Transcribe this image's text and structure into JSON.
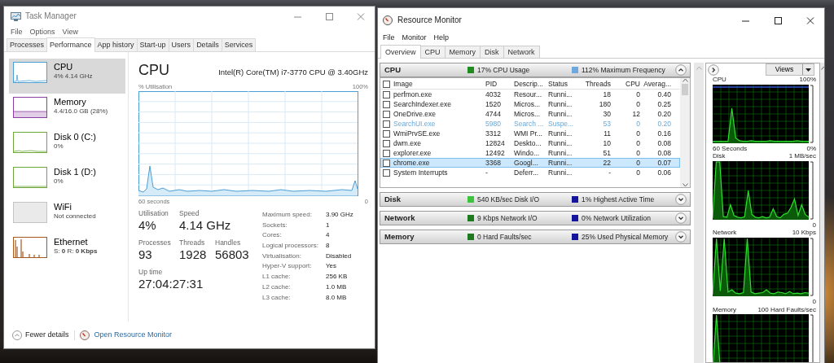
{
  "task_manager": {
    "title": "Task Manager",
    "menu": [
      "File",
      "Options",
      "View"
    ],
    "tabs": [
      {
        "label": "Processes",
        "selected": false
      },
      {
        "label": "Performance",
        "selected": true
      },
      {
        "label": "App history",
        "selected": false
      },
      {
        "label": "Start-up",
        "selected": false
      },
      {
        "label": "Users",
        "selected": false
      },
      {
        "label": "Details",
        "selected": false
      },
      {
        "label": "Services",
        "selected": false
      }
    ],
    "sidebar": [
      {
        "name": "CPU",
        "detail": "4% 4.14 GHz",
        "selected": true,
        "color": "#4b9fd5"
      },
      {
        "name": "Memory",
        "detail": "4.4/16.0 GB (28%)",
        "selected": false,
        "color": "#8b3f9e"
      },
      {
        "name": "Disk 0 (C:)",
        "detail": "0%",
        "selected": false,
        "color": "#6fa83a"
      },
      {
        "name": "Disk 1 (D:)",
        "detail": "0%",
        "selected": false,
        "color": "#6fa83a"
      },
      {
        "name": "WiFi",
        "detail": "Not connected",
        "selected": false,
        "color": "#c4c4c4"
      },
      {
        "name": "Ethernet",
        "detail": "S: **0** R: **0 Kbps**",
        "selected": false,
        "color": "#a7581f"
      }
    ],
    "panel": {
      "title": "CPU",
      "model": "Intel(R) Core(TM) i7-3770 CPU @ 3.40GHz",
      "graph_label": "% Utilisation",
      "graph_max": "100%",
      "graph_span": "60 seconds",
      "graph_min": "0",
      "stats": [
        {
          "label": "Utilisation",
          "value": "4%"
        },
        {
          "label": "Speed",
          "value": "4.14 GHz"
        },
        {
          "label": "Processes",
          "value": "93"
        },
        {
          "label": "Threads",
          "value": "1928"
        },
        {
          "label": "Handles",
          "value": "56803"
        },
        {
          "label": "Up time",
          "value": "27:04:27:31"
        }
      ],
      "specs": [
        {
          "label": "Maximum speed:",
          "value": "3.90 GHz"
        },
        {
          "label": "Sockets:",
          "value": "1"
        },
        {
          "label": "Cores:",
          "value": "4"
        },
        {
          "label": "Logical processors:",
          "value": "8"
        },
        {
          "label": "Virtualisation:",
          "value": "Disabled"
        },
        {
          "label": "Hyper-V support:",
          "value": "Yes"
        },
        {
          "label": "L1 cache:",
          "value": "256 KB"
        },
        {
          "label": "L2 cache:",
          "value": "1.0 MB"
        },
        {
          "label": "L3 cache:",
          "value": "8.0 MB"
        }
      ]
    },
    "footer": {
      "fewer_details": "Fewer details",
      "link": "Open Resource Monitor"
    }
  },
  "resource_monitor": {
    "title": "Resource Monitor",
    "menu": [
      "File",
      "Monitor",
      "Help"
    ],
    "tabs": [
      {
        "label": "Overview",
        "selected": true
      },
      {
        "label": "CPU",
        "selected": false
      },
      {
        "label": "Memory",
        "selected": false
      },
      {
        "label": "Disk",
        "selected": false
      },
      {
        "label": "Network",
        "selected": false
      }
    ],
    "sections": [
      {
        "name": "CPU",
        "expanded": true,
        "indicators": [
          {
            "text": "17% CPU Usage",
            "color": "#1e8c1e"
          },
          {
            "text": "112% Maximum Frequency",
            "color": "#6fa8dc"
          }
        ],
        "table": {
          "select_all_checked": false,
          "columns": [
            "Image",
            "PID",
            "Descrip...",
            "Status",
            "Threads",
            "CPU",
            "Averag..."
          ],
          "rows": [
            {
              "image": "perfmon.exe",
              "pid": "4032",
              "description": "Resour...",
              "status": "Runni...",
              "threads": "18",
              "cpu": "0",
              "average": "0.40",
              "checked": false,
              "suspended": false,
              "selected": false
            },
            {
              "image": "SearchIndexer.exe",
              "pid": "1520",
              "description": "Micros...",
              "status": "Runni...",
              "threads": "180",
              "cpu": "0",
              "average": "0.25",
              "checked": false,
              "suspended": false,
              "selected": false
            },
            {
              "image": "OneDrive.exe",
              "pid": "4744",
              "description": "Micros...",
              "status": "Runni...",
              "threads": "30",
              "cpu": "12",
              "average": "0.20",
              "checked": false,
              "suspended": false,
              "selected": false
            },
            {
              "image": "SearchUI.exe",
              "pid": "5980",
              "description": "Search ...",
              "status": "Suspe...",
              "threads": "53",
              "cpu": "0",
              "average": "0.20",
              "checked": false,
              "suspended": true,
              "selected": false
            },
            {
              "image": "WmiPrvSE.exe",
              "pid": "3312",
              "description": "WMI Pr...",
              "status": "Runni...",
              "threads": "11",
              "cpu": "0",
              "average": "0.16",
              "checked": false,
              "suspended": false,
              "selected": false
            },
            {
              "image": "dwm.exe",
              "pid": "12824",
              "description": "Deskto...",
              "status": "Runni...",
              "threads": "10",
              "cpu": "0",
              "average": "0.08",
              "checked": false,
              "suspended": false,
              "selected": false
            },
            {
              "image": "explorer.exe",
              "pid": "12492",
              "description": "Windo...",
              "status": "Runni...",
              "threads": "51",
              "cpu": "0",
              "average": "0.08",
              "checked": false,
              "suspended": false,
              "selected": false
            },
            {
              "image": "chrome.exe",
              "pid": "3368",
              "description": "Googl...",
              "status": "Runni...",
              "threads": "22",
              "cpu": "0",
              "average": "0.07",
              "checked": false,
              "suspended": false,
              "selected": true
            },
            {
              "image": "System Interrupts",
              "pid": "-",
              "description": "Deferr...",
              "status": "Runni...",
              "threads": "-",
              "cpu": "0",
              "average": "0.06",
              "checked": false,
              "suspended": false,
              "selected": false
            }
          ]
        }
      },
      {
        "name": "Disk",
        "expanded": false,
        "indicators": [
          {
            "text": "540 KB/sec Disk I/O",
            "color": "#3cc43c"
          },
          {
            "text": "1% Highest Active Time",
            "color": "#14149c"
          }
        ]
      },
      {
        "name": "Network",
        "expanded": false,
        "indicators": [
          {
            "text": "9 Kbps Network I/O",
            "color": "#1e7a1e"
          },
          {
            "text": "0% Network Utilization",
            "color": "#14149c"
          }
        ]
      },
      {
        "name": "Memory",
        "expanded": false,
        "indicators": [
          {
            "text": "0 Hard Faults/sec",
            "color": "#1e7a1e"
          },
          {
            "text": "25% Used Physical Memory",
            "color": "#14149c"
          }
        ]
      }
    ],
    "side_panel": {
      "views": "Views",
      "graphs": [
        {
          "title": "CPU",
          "max": "100%",
          "span": "60 Seconds",
          "min": "0%"
        },
        {
          "title": "Disk",
          "max": "1 MB/sec",
          "min": "0"
        },
        {
          "title": "Network",
          "max": "10 Kbps",
          "min": "0"
        },
        {
          "title": "Memory",
          "max": "100 Hard Faults/sec"
        }
      ]
    }
  }
}
